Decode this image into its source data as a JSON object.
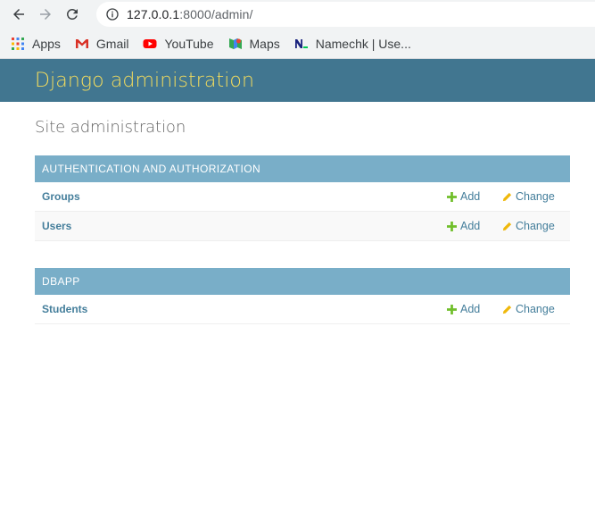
{
  "browser": {
    "url_host": "127.0.0.1",
    "url_rest": ":8000/admin/",
    "bookmarks": [
      {
        "label": "Apps",
        "icon": "apps-grid-icon"
      },
      {
        "label": "Gmail",
        "icon": "gmail-icon"
      },
      {
        "label": "YouTube",
        "icon": "youtube-icon"
      },
      {
        "label": "Maps",
        "icon": "maps-icon"
      },
      {
        "label": "Namechk | Use...",
        "icon": "namechk-icon"
      }
    ]
  },
  "header": {
    "branding": "Django administration"
  },
  "main": {
    "title": "Site administration",
    "modules": [
      {
        "caption": "AUTHENTICATION AND AUTHORIZATION",
        "rows": [
          {
            "name": "Groups",
            "add": "Add",
            "change": "Change"
          },
          {
            "name": "Users",
            "add": "Add",
            "change": "Change"
          }
        ]
      },
      {
        "caption": "DBAPP",
        "rows": [
          {
            "name": "Students",
            "add": "Add",
            "change": "Change"
          }
        ]
      }
    ]
  },
  "colors": {
    "header_bg": "#417690",
    "branding": "#f5dd5d",
    "module_caption_bg": "#79aec8",
    "link": "#447e9b",
    "add_icon": "#70bf2b",
    "change_icon": "#efb80b"
  }
}
